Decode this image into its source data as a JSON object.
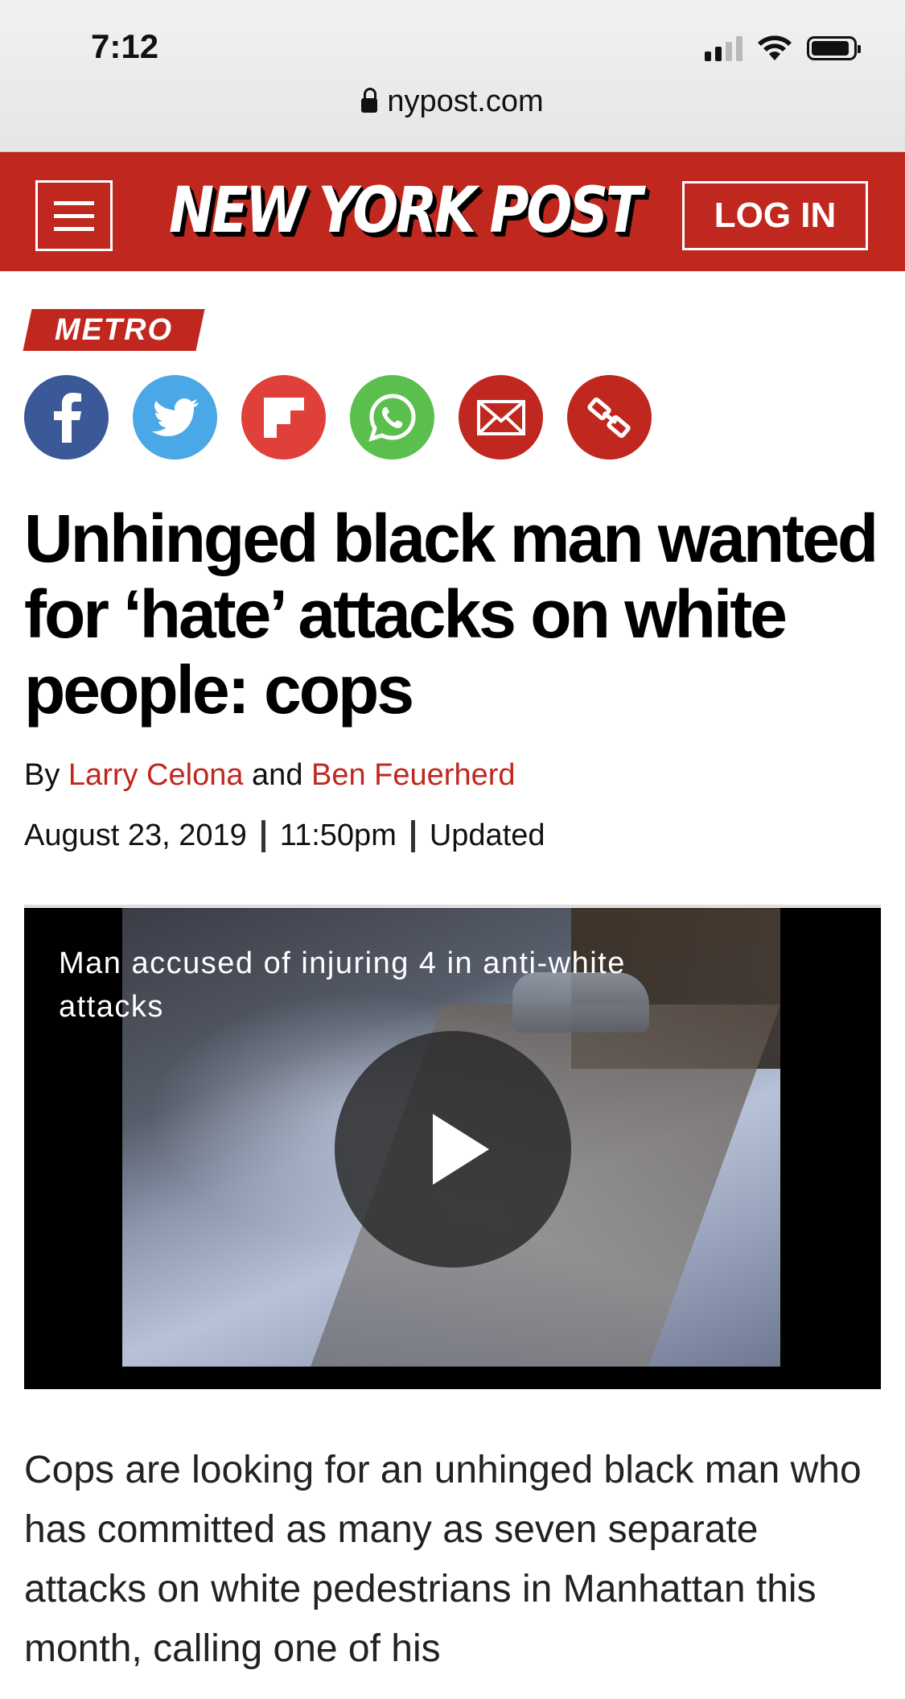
{
  "status_bar": {
    "time": "7:12"
  },
  "url_bar": {
    "domain": "nypost.com"
  },
  "header": {
    "logo": "NEW YORK POST",
    "login_label": "LOG IN"
  },
  "article": {
    "section": "METRO",
    "share_icons": [
      "facebook-icon",
      "twitter-icon",
      "flipboard-icon",
      "whatsapp-icon",
      "email-icon",
      "link-icon"
    ],
    "headline": "Unhinged black man wanted for ‘hate’ attacks on white people: cops",
    "byline": {
      "prefix": "By",
      "author1": "Larry Celona",
      "conjunction": "and",
      "author2": "Ben Feuerherd"
    },
    "date": "August 23, 2019",
    "time": "11:50pm",
    "updated_label": "Updated",
    "video": {
      "caption": "Man accused of injuring 4 in anti-white attacks"
    },
    "body": "Cops are looking for an unhinged black man who has committed as many as seven separate attacks on white pedestrians in Manhattan this month, calling one of his"
  },
  "colors": {
    "brand_red": "#c0271e",
    "facebook": "#3b5998",
    "twitter": "#4aa8e6",
    "whatsapp": "#5bbf4e"
  }
}
